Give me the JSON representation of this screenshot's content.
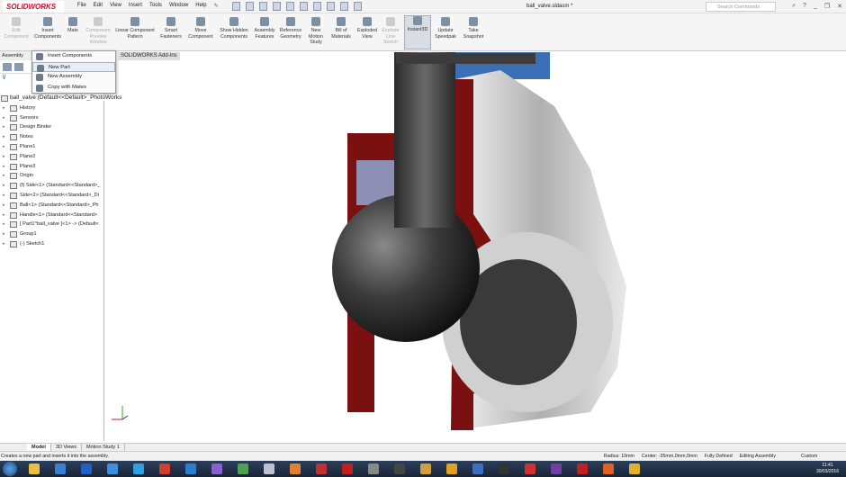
{
  "app": {
    "logo": "SOLIDWORKS",
    "document_title": "ball_valve.sldasm *",
    "search_placeholder": "Search Commands"
  },
  "menu": [
    "File",
    "Edit",
    "View",
    "Insert",
    "Tools",
    "Window",
    "Help"
  ],
  "ribbon": [
    {
      "label": "Edit Component",
      "disabled": true
    },
    {
      "label": "Insert Components"
    },
    {
      "label": "Mate"
    },
    {
      "label": "Component Preview Window",
      "disabled": true
    },
    {
      "label": "Linear Component Pattern"
    },
    {
      "label": "Smart Fasteners"
    },
    {
      "label": "Move Component"
    },
    {
      "label": "Show Hidden Components"
    },
    {
      "label": "Assembly Features"
    },
    {
      "label": "Reference Geometry"
    },
    {
      "label": "New Motion Study"
    },
    {
      "label": "Bill of Materials"
    },
    {
      "label": "Exploded View"
    },
    {
      "label": "Explode Line Sketch",
      "disabled": true
    },
    {
      "label": "Instant3D",
      "active": true
    },
    {
      "label": "Update Speedpak"
    },
    {
      "label": "Take Snapshot"
    }
  ],
  "tabs": {
    "assembly": "Assembly",
    "addins": "SOLIDWORKS Add-Ins"
  },
  "dropdown": [
    "Insert Components",
    "New Part",
    "New Assembly",
    "Copy with Mates"
  ],
  "tree": {
    "root": "ball_valve  (Default<<Default>_PhotoWorks",
    "items": [
      "History",
      "Sensors",
      "Design Binder",
      "Notes",
      "Plane1",
      "Plane2",
      "Plane3",
      "Origin",
      "(f) Side<1> (Standard<<Standard>_",
      "Side<2> (Standard<<Standard>_Di",
      "Ball<1> (Standard<<Standard>_Ph",
      "Handle<1> (Standard<<Standard>",
      "[ Part1^ball_valve ]<1> -> (Default<",
      "Group1",
      "(-) Sketch1"
    ]
  },
  "bottom_tabs": [
    "Model",
    "3D Views",
    "Motion Study 1"
  ],
  "status": {
    "hint": "Creates a new part and inserts it into the assembly.",
    "radius": "Radius: 10mm",
    "center": "Center: -35mm,0mm,0mm",
    "defined": "Fully Defined",
    "mode": "Editing Assembly",
    "units": "Custom"
  },
  "clock": {
    "time": "11:41",
    "date": "30/03/2016"
  },
  "colors": {
    "brand": "#c8102e",
    "cut_face": "#7a1010",
    "ball": "#3a3a3a",
    "body": "#d8d8d8"
  }
}
